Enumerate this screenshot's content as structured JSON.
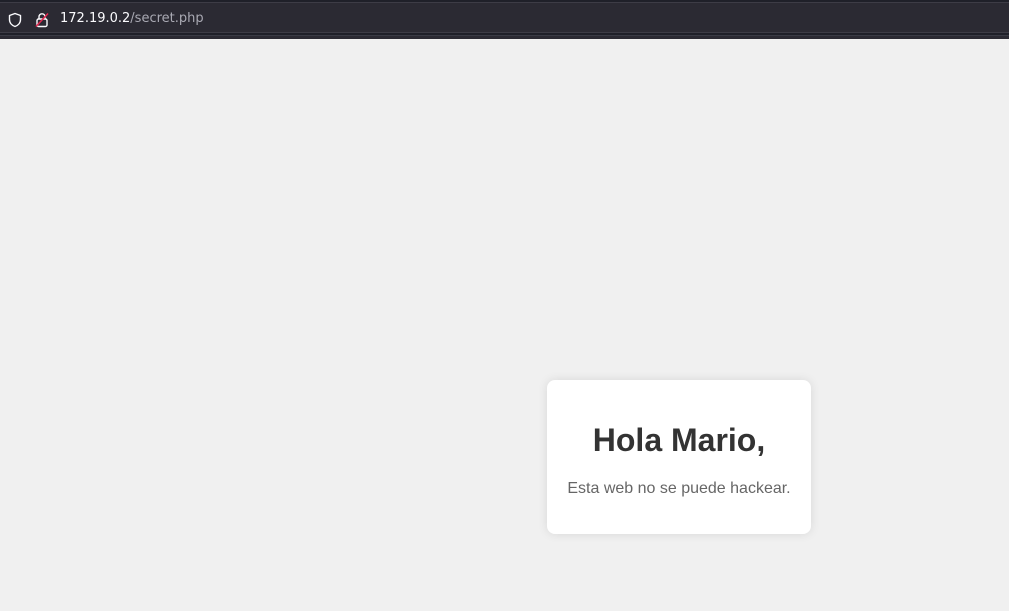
{
  "browser": {
    "url_host": "172.19.0.2",
    "url_path": "/secret.php",
    "icons": {
      "tracking_protection": "shield-icon",
      "connection": "insecure-lock-icon"
    },
    "colors": {
      "toolbar_bg": "#2b2a33",
      "url_host_text": "#fbfbfe",
      "url_path_text": "#a9a9b3",
      "insecure_slash": "#e22850"
    }
  },
  "page": {
    "background": "#f0f0f0",
    "card": {
      "heading": "Hola Mario,",
      "message": "Esta web no se puede hackear."
    }
  }
}
